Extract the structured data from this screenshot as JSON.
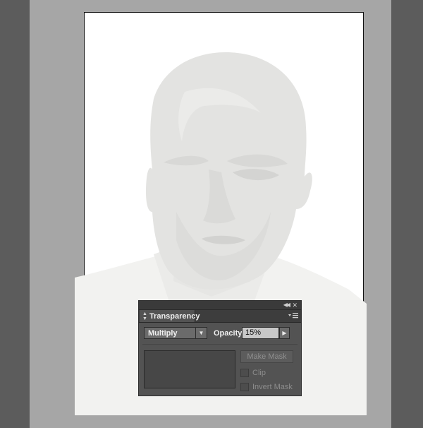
{
  "canvas": {
    "pasteboard_color": "#a6a6a6",
    "workspace_color": "#5c5c5c",
    "artboard_color": "#ffffff",
    "art_fill_color": "#e3e3e1"
  },
  "panel": {
    "title": "Transparency",
    "collapse_icon": "double-chevron-left",
    "close_icon": "close",
    "menu_icon": "panel-menu",
    "blend_mode": "Multiply",
    "opacity_label": "Opacity:",
    "opacity_value": "15%",
    "make_mask_label": "Make Mask",
    "clip_label": "Clip",
    "invert_mask_label": "Invert Mask"
  }
}
